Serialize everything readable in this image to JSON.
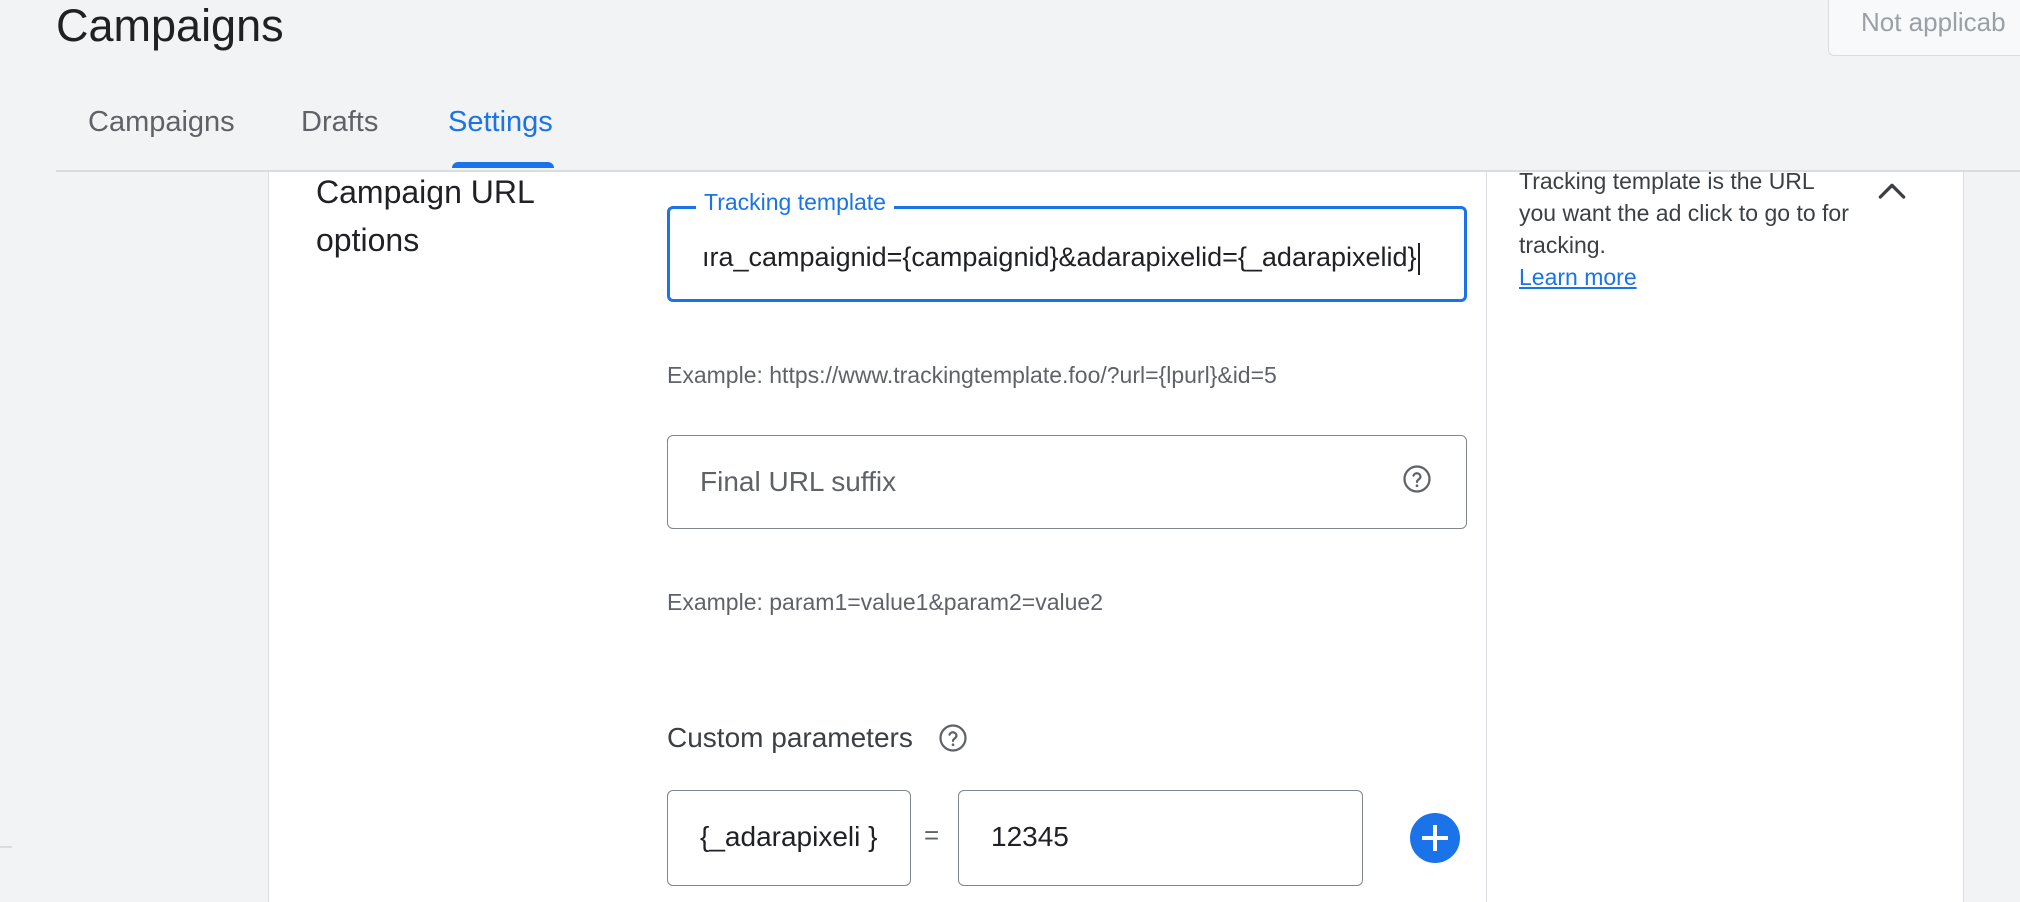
{
  "header": {
    "title": "Campaigns",
    "status_select": "Not applicab"
  },
  "tabs": [
    {
      "label": "Campaigns",
      "active": false
    },
    {
      "label": "Drafts",
      "active": false
    },
    {
      "label": "Settings",
      "active": true
    }
  ],
  "section": {
    "title": "Campaign URL options",
    "tracking_template": {
      "label": "Tracking template",
      "value": "ıra_campaignid={campaignid}&adarapixelid={_adarapixelid}",
      "example": "Example: https://www.trackingtemplate.foo/?url={lpurl}&id=5"
    },
    "final_url_suffix": {
      "placeholder": "Final URL suffix",
      "example": "Example: param1=value1&param2=value2"
    },
    "custom_parameters": {
      "label": "Custom parameters",
      "key": "{_adarapixeli }",
      "equals": "=",
      "value": "12345"
    }
  },
  "help_panel": {
    "text": "Tracking template is the URL you want the ad click to go to for tracking.",
    "learn_more": "Learn more"
  },
  "colors": {
    "accent": "#1a73e8",
    "text": "#202124",
    "muted": "#5f6368",
    "border": "#80868b",
    "background": "#f1f3f4"
  },
  "icons": {
    "help": "help-circle-icon",
    "collapse": "chevron-up-icon",
    "add": "add-circle-icon"
  }
}
